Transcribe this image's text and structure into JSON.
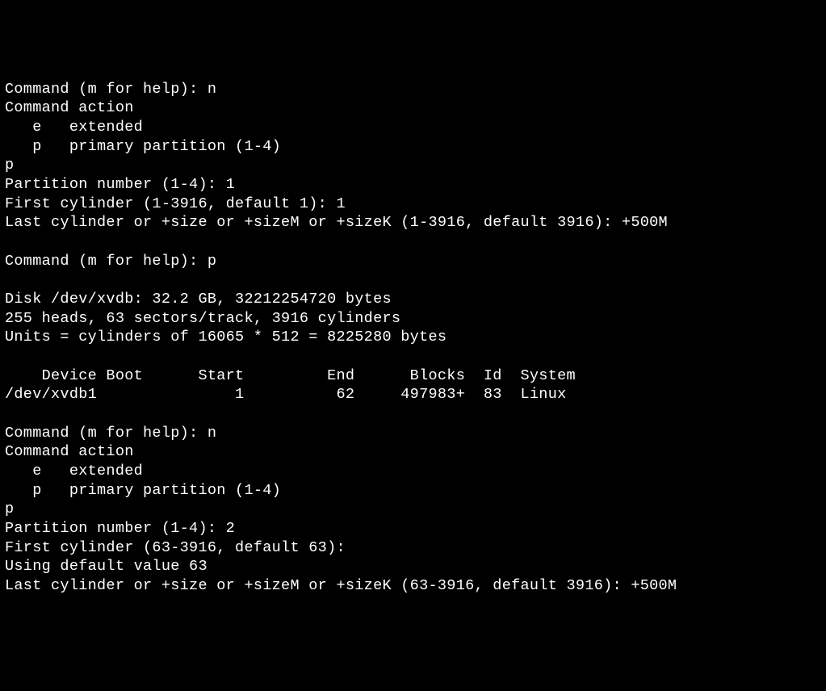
{
  "lines": [
    "Command (m for help): n",
    "Command action",
    "   e   extended",
    "   p   primary partition (1-4)",
    "p",
    "Partition number (1-4): 1",
    "First cylinder (1-3916, default 1): 1",
    "Last cylinder or +size or +sizeM or +sizeK (1-3916, default 3916): +500M",
    "",
    "Command (m for help): p",
    "",
    "Disk /dev/xvdb: 32.2 GB, 32212254720 bytes",
    "255 heads, 63 sectors/track, 3916 cylinders",
    "Units = cylinders of 16065 * 512 = 8225280 bytes",
    "",
    "    Device Boot      Start         End      Blocks  Id  System",
    "/dev/xvdb1               1          62     497983+  83  Linux",
    "",
    "Command (m for help): n",
    "Command action",
    "   e   extended",
    "   p   primary partition (1-4)",
    "p",
    "Partition number (1-4): 2",
    "First cylinder (63-3916, default 63):",
    "Using default value 63",
    "Last cylinder or +size or +sizeM or +sizeK (63-3916, default 3916): +500M",
    ""
  ]
}
